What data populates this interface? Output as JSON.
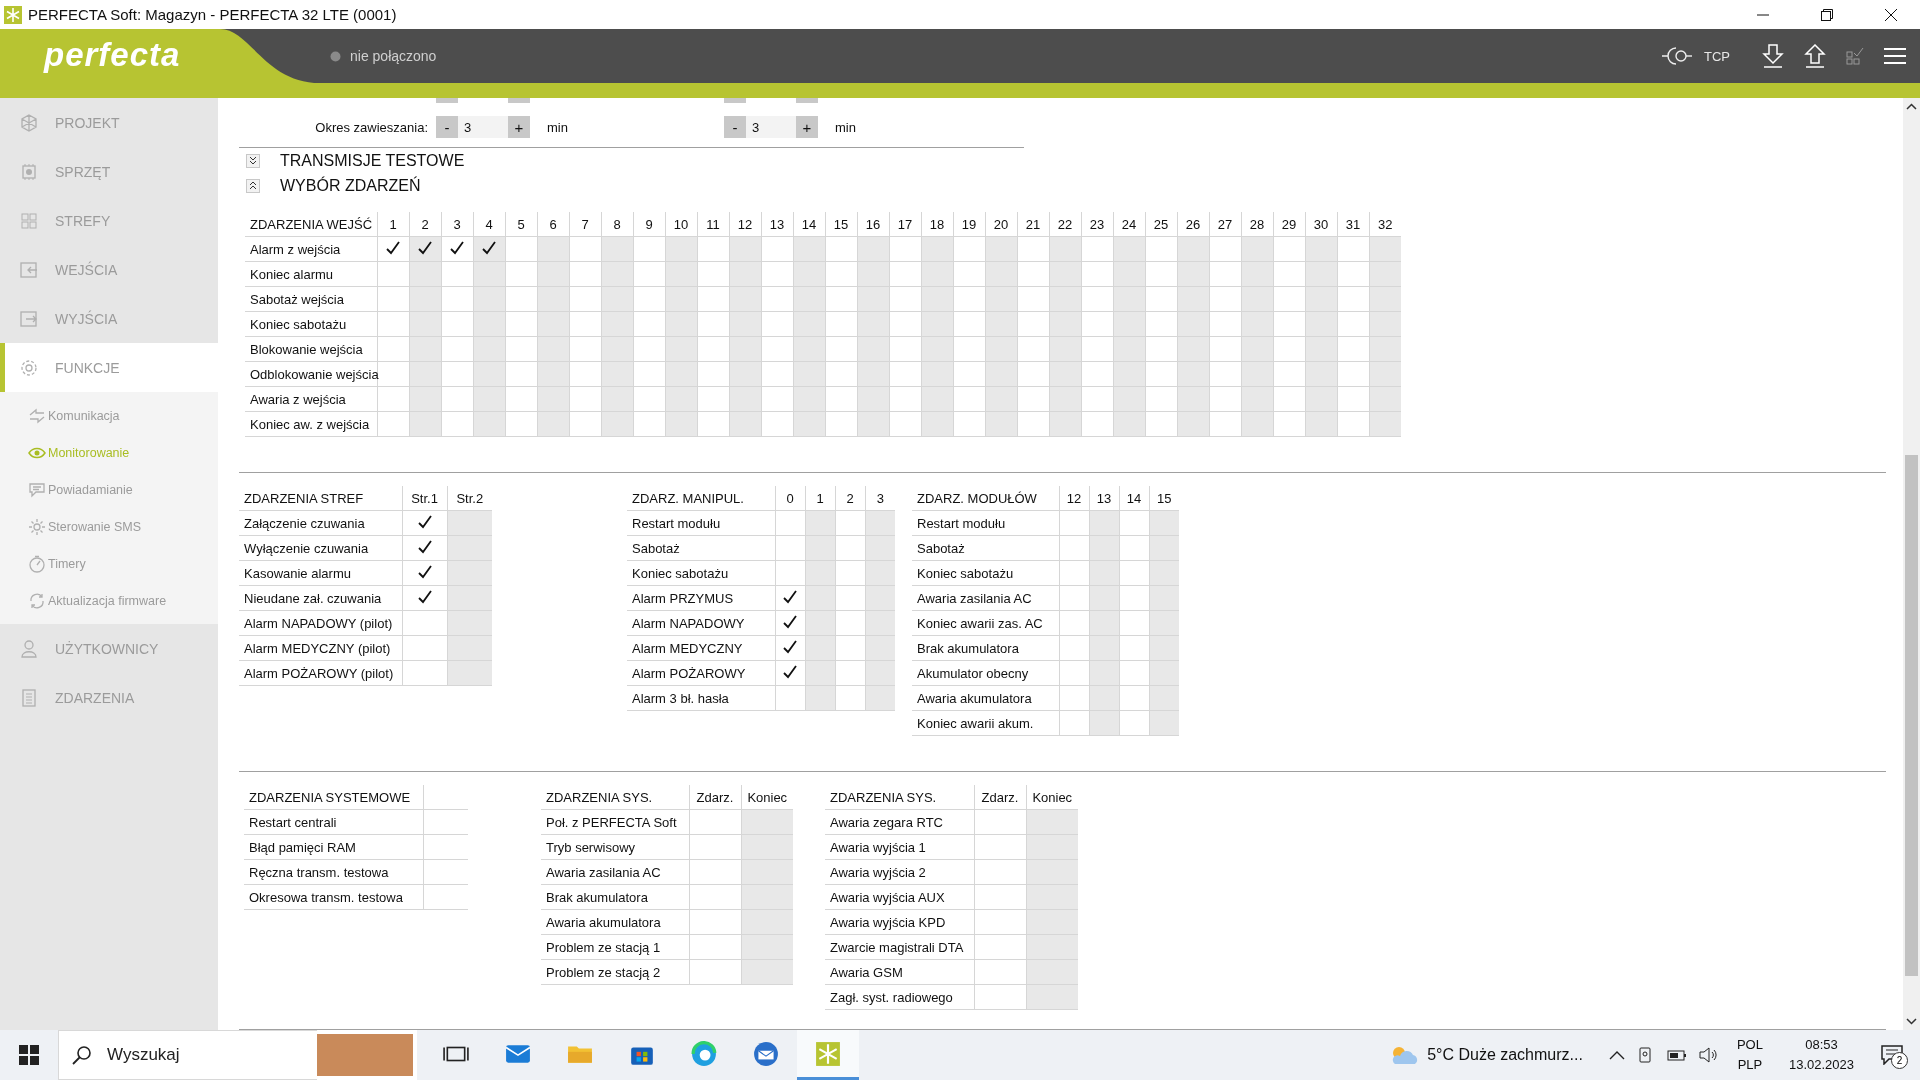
{
  "window": {
    "title": "PERFECTA Soft: Magazyn - PERFECTA 32 LTE  (0001)"
  },
  "header": {
    "logo": "perfecta",
    "status": "nie połączono",
    "connection": "TCP"
  },
  "sidebar": {
    "items": [
      {
        "label": "PROJEKT",
        "selected": false
      },
      {
        "label": "SPRZĘT",
        "selected": false
      },
      {
        "label": "STREFY",
        "selected": false
      },
      {
        "label": "WEJŚCIA",
        "selected": false
      },
      {
        "label": "WYJŚCIA",
        "selected": false
      },
      {
        "label": "FUNKCJE",
        "selected": true,
        "children": [
          {
            "label": "Komunikacja",
            "selected": false
          },
          {
            "label": "Monitorowanie",
            "selected": true
          },
          {
            "label": "Powiadamianie",
            "selected": false
          },
          {
            "label": "Sterowanie SMS",
            "selected": false
          },
          {
            "label": "Timery",
            "selected": false
          },
          {
            "label": "Aktualizacja firmware",
            "selected": false
          }
        ]
      },
      {
        "label": "UŻYTKOWNICY",
        "selected": false
      },
      {
        "label": "ZDARZENIA",
        "selected": false
      }
    ]
  },
  "suspension": {
    "label": "Okres zawieszania:",
    "steppers": [
      {
        "minus": "-",
        "value": "3",
        "plus": "+",
        "unit": "min"
      },
      {
        "minus": "-",
        "value": "3",
        "plus": "+",
        "unit": "min"
      }
    ]
  },
  "sections": [
    {
      "title": "TRANSMISJE TESTOWE",
      "expanded": false
    },
    {
      "title": "WYBÓR ZDARZEŃ",
      "expanded": true
    }
  ],
  "input_events": {
    "title": "ZDARZENIA WEJŚĆ",
    "columns": [
      "1",
      "2",
      "3",
      "4",
      "5",
      "6",
      "7",
      "8",
      "9",
      "10",
      "11",
      "12",
      "13",
      "14",
      "15",
      "16",
      "17",
      "18",
      "19",
      "20",
      "21",
      "22",
      "23",
      "24",
      "25",
      "26",
      "27",
      "28",
      "29",
      "30",
      "31",
      "32"
    ],
    "rows": [
      {
        "label": "Alarm z wejścia",
        "checks": [
          true,
          true,
          true,
          true,
          false,
          false,
          false,
          false,
          false,
          false,
          false,
          false,
          false,
          false,
          false,
          false,
          false,
          false,
          false,
          false,
          false,
          false,
          false,
          false,
          false,
          false,
          false,
          false,
          false,
          false,
          false,
          false
        ]
      },
      {
        "label": "Koniec alarmu",
        "checks": [
          false,
          false,
          false,
          false,
          false,
          false,
          false,
          false,
          false,
          false,
          false,
          false,
          false,
          false,
          false,
          false,
          false,
          false,
          false,
          false,
          false,
          false,
          false,
          false,
          false,
          false,
          false,
          false,
          false,
          false,
          false,
          false
        ]
      },
      {
        "label": "Sabotaż wejścia",
        "checks": [
          false,
          false,
          false,
          false,
          false,
          false,
          false,
          false,
          false,
          false,
          false,
          false,
          false,
          false,
          false,
          false,
          false,
          false,
          false,
          false,
          false,
          false,
          false,
          false,
          false,
          false,
          false,
          false,
          false,
          false,
          false,
          false
        ]
      },
      {
        "label": "Koniec sabotażu",
        "checks": [
          false,
          false,
          false,
          false,
          false,
          false,
          false,
          false,
          false,
          false,
          false,
          false,
          false,
          false,
          false,
          false,
          false,
          false,
          false,
          false,
          false,
          false,
          false,
          false,
          false,
          false,
          false,
          false,
          false,
          false,
          false,
          false
        ]
      },
      {
        "label": "Blokowanie wejścia",
        "checks": [
          false,
          false,
          false,
          false,
          false,
          false,
          false,
          false,
          false,
          false,
          false,
          false,
          false,
          false,
          false,
          false,
          false,
          false,
          false,
          false,
          false,
          false,
          false,
          false,
          false,
          false,
          false,
          false,
          false,
          false,
          false,
          false
        ]
      },
      {
        "label": "Odblokowanie wejścia",
        "checks": [
          false,
          false,
          false,
          false,
          false,
          false,
          false,
          false,
          false,
          false,
          false,
          false,
          false,
          false,
          false,
          false,
          false,
          false,
          false,
          false,
          false,
          false,
          false,
          false,
          false,
          false,
          false,
          false,
          false,
          false,
          false,
          false
        ]
      },
      {
        "label": "Awaria z wejścia",
        "checks": [
          false,
          false,
          false,
          false,
          false,
          false,
          false,
          false,
          false,
          false,
          false,
          false,
          false,
          false,
          false,
          false,
          false,
          false,
          false,
          false,
          false,
          false,
          false,
          false,
          false,
          false,
          false,
          false,
          false,
          false,
          false,
          false
        ]
      },
      {
        "label": "Koniec aw. z wejścia",
        "checks": [
          false,
          false,
          false,
          false,
          false,
          false,
          false,
          false,
          false,
          false,
          false,
          false,
          false,
          false,
          false,
          false,
          false,
          false,
          false,
          false,
          false,
          false,
          false,
          false,
          false,
          false,
          false,
          false,
          false,
          false,
          false,
          false
        ]
      }
    ]
  },
  "event_groups": [
    [
      {
        "title": "ZDARZENIA STREF",
        "columns": [
          "Str.1",
          "Str.2"
        ],
        "rows": [
          {
            "label": "Załączenie czuwania",
            "checks": [
              true,
              false
            ]
          },
          {
            "label": "Wyłączenie czuwania",
            "checks": [
              true,
              false
            ]
          },
          {
            "label": "Kasowanie alarmu",
            "checks": [
              true,
              false
            ]
          },
          {
            "label": "Nieudane zał. czuwania",
            "checks": [
              true,
              false
            ]
          },
          {
            "label": "Alarm NAPADOWY (pilot)",
            "checks": [
              false,
              false
            ]
          },
          {
            "label": "Alarm MEDYCZNY (pilot)",
            "checks": [
              false,
              false
            ]
          },
          {
            "label": "Alarm POŻAROWY (pilot)",
            "checks": [
              false,
              false
            ]
          }
        ]
      },
      {
        "title": "ZDARZ. MANIPUL.",
        "columns": [
          "0",
          "1",
          "2",
          "3"
        ],
        "rows": [
          {
            "label": "Restart modułu",
            "checks": [
              false,
              false,
              false,
              false
            ]
          },
          {
            "label": "Sabotaż",
            "checks": [
              false,
              false,
              false,
              false
            ]
          },
          {
            "label": "Koniec sabotażu",
            "checks": [
              false,
              false,
              false,
              false
            ]
          },
          {
            "label": "Alarm PRZYMUS",
            "checks": [
              true,
              false,
              false,
              false
            ]
          },
          {
            "label": "Alarm NAPADOWY",
            "checks": [
              true,
              false,
              false,
              false
            ]
          },
          {
            "label": "Alarm MEDYCZNY",
            "checks": [
              true,
              false,
              false,
              false
            ]
          },
          {
            "label": "Alarm POŻAROWY",
            "checks": [
              true,
              false,
              false,
              false
            ]
          },
          {
            "label": "Alarm 3 bł. hasła",
            "checks": [
              false,
              false,
              false,
              false
            ]
          }
        ]
      },
      {
        "title": "ZDARZ. MODUŁÓW",
        "columns": [
          "12",
          "13",
          "14",
          "15"
        ],
        "rows": [
          {
            "label": "Restart modułu",
            "checks": [
              false,
              false,
              false,
              false
            ]
          },
          {
            "label": "Sabotaż",
            "checks": [
              false,
              false,
              false,
              false
            ]
          },
          {
            "label": "Koniec sabotażu",
            "checks": [
              false,
              false,
              false,
              false
            ]
          },
          {
            "label": "Awaria zasilania AC",
            "checks": [
              false,
              false,
              false,
              false
            ]
          },
          {
            "label": "Koniec awarii zas. AC",
            "checks": [
              false,
              false,
              false,
              false
            ]
          },
          {
            "label": "Brak akumulatora",
            "checks": [
              false,
              false,
              false,
              false
            ]
          },
          {
            "label": "Akumulator obecny",
            "checks": [
              false,
              false,
              false,
              false
            ]
          },
          {
            "label": "Awaria akumulatora",
            "checks": [
              false,
              false,
              false,
              false
            ]
          },
          {
            "label": "Koniec awarii akum.",
            "checks": [
              false,
              false,
              false,
              false
            ]
          }
        ]
      }
    ],
    [
      {
        "title": "ZDARZENIA SYSTEMOWE",
        "rows": [
          {
            "label": "Restart centrali",
            "checks": [
              false
            ]
          },
          {
            "label": "Błąd pamięci RAM",
            "checks": [
              false
            ]
          },
          {
            "label": "Ręczna transm. testowa",
            "checks": [
              false
            ]
          },
          {
            "label": "Okresowa transm. testowa",
            "checks": [
              false
            ]
          }
        ]
      },
      {
        "title": "ZDARZENIA SYS.",
        "columns": [
          "Zdarz.",
          "Koniec"
        ],
        "rows": [
          {
            "label": "Poł. z PERFECTA Soft",
            "checks": [
              false,
              false
            ]
          },
          {
            "label": "Tryb serwisowy",
            "checks": [
              false,
              false
            ]
          },
          {
            "label": "Awaria zasilania AC",
            "checks": [
              false,
              false
            ]
          },
          {
            "label": "Brak akumulatora",
            "checks": [
              false,
              false
            ]
          },
          {
            "label": "Awaria akumulatora",
            "checks": [
              false,
              false
            ]
          },
          {
            "label": "Problem ze stacją 1",
            "checks": [
              false,
              false
            ]
          },
          {
            "label": "Problem ze stacją 2",
            "checks": [
              false,
              false
            ]
          }
        ]
      },
      {
        "title": "ZDARZENIA SYS.",
        "columns": [
          "Zdarz.",
          "Koniec"
        ],
        "rows": [
          {
            "label": "Awaria zegara RTC",
            "checks": [
              false,
              false
            ]
          },
          {
            "label": "Awaria wyjścia 1",
            "checks": [
              false,
              false
            ]
          },
          {
            "label": "Awaria wyjścia 2",
            "checks": [
              false,
              false
            ]
          },
          {
            "label": "Awaria wyjścia AUX",
            "checks": [
              false,
              false
            ]
          },
          {
            "label": "Awaria wyjścia KPD",
            "checks": [
              false,
              false
            ]
          },
          {
            "label": "Zwarcie magistrali DTA",
            "checks": [
              false,
              false
            ]
          },
          {
            "label": "Awaria GSM",
            "checks": [
              false,
              false
            ]
          },
          {
            "label": "Zagł. syst. radiowego",
            "checks": [
              false,
              false
            ]
          }
        ]
      }
    ]
  ],
  "taskbar": {
    "search_placeholder": "Wyszukaj",
    "apps": [
      {
        "selected": false
      },
      {
        "selected": false
      },
      {
        "selected": false
      },
      {
        "selected": false
      },
      {
        "selected": false
      },
      {
        "selected": false
      },
      {
        "selected": true
      }
    ],
    "weather": "5°C  Duże zachmurz...",
    "language": "POL",
    "layout": "PLP",
    "time": "08:53",
    "date": "13.02.2023",
    "notifications": "2"
  }
}
